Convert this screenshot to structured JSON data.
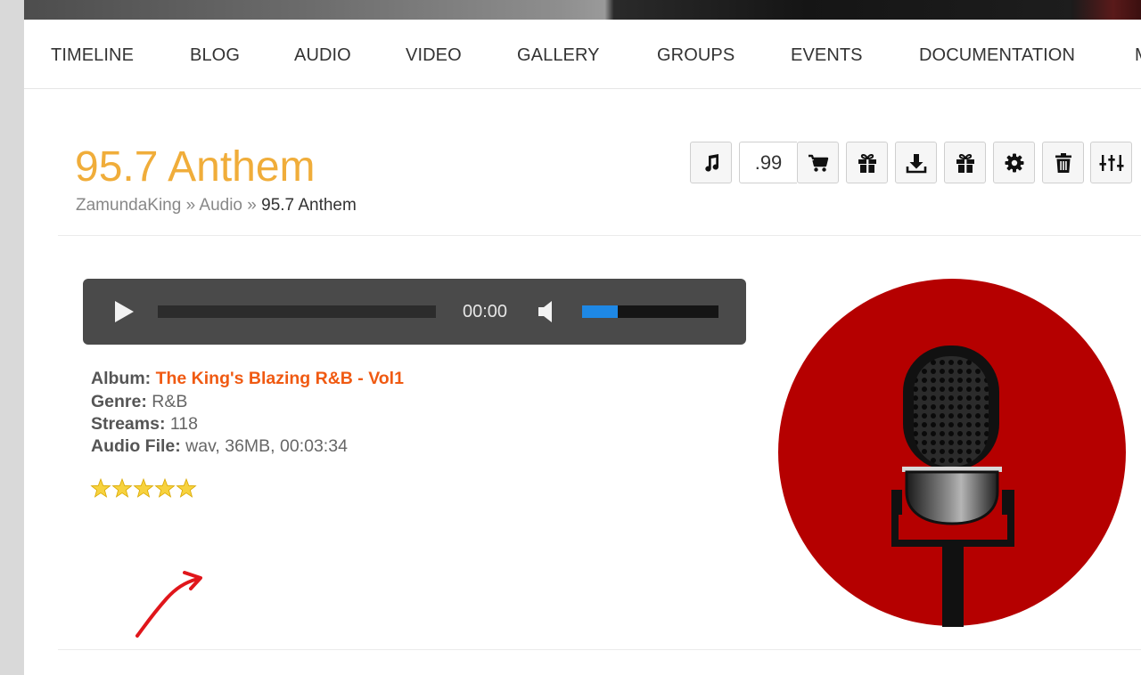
{
  "nav": {
    "items": [
      "TIMELINE",
      "BLOG",
      "AUDIO",
      "VIDEO",
      "GALLERY",
      "GROUPS",
      "EVENTS",
      "DOCUMENTATION",
      "M"
    ]
  },
  "page": {
    "title": "95.7 Anthem",
    "breadcrumb": [
      "ZamundaKing",
      "Audio",
      "95.7 Anthem"
    ],
    "separator": "»"
  },
  "toolbar": {
    "price": ".99",
    "icons": [
      "music-note-icon",
      "cart-icon",
      "gift-icon",
      "download-icon",
      "gift-icon",
      "gear-icon",
      "trash-icon",
      "sliders-icon"
    ]
  },
  "player": {
    "time": "00:00",
    "progress": 0,
    "volume": 0.26
  },
  "details": {
    "album_label": "Album:",
    "album": "The King's Blazing R&B - Vol1",
    "genre_label": "Genre:",
    "genre": "R&B",
    "streams_label": "Streams:",
    "streams": "118",
    "file_label": "Audio File:",
    "file": "wav, 36MB, 00:03:34"
  },
  "rating": {
    "value": 5,
    "max": 5
  },
  "colors": {
    "title": "#f0ad3a",
    "album_link": "#f05a12",
    "volume_fill": "#1e88e5",
    "player_bg": "#4a4a4a",
    "artwork_red": "#b50000",
    "star": "#f7d23e",
    "arrow": "#e0161b"
  }
}
